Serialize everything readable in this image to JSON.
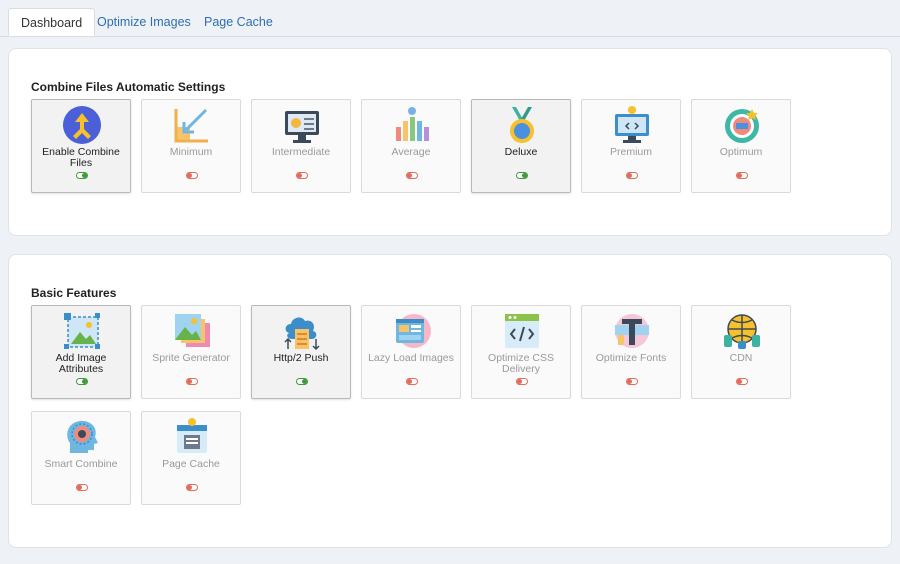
{
  "tabs": [
    {
      "label": "Dashboard",
      "active": true
    },
    {
      "label": "Optimize Images",
      "active": false
    },
    {
      "label": "Page Cache",
      "active": false
    }
  ],
  "combine": {
    "title": "Combine Files Automatic Settings",
    "cards": [
      {
        "label": "Enable Combine Files",
        "icon": "combine-arrows-icon",
        "enabled": true
      },
      {
        "label": "Minimum",
        "icon": "minimum-arrow-icon",
        "enabled": false
      },
      {
        "label": "Intermediate",
        "icon": "monitor-settings-icon",
        "enabled": false
      },
      {
        "label": "Average",
        "icon": "average-bars-icon",
        "enabled": false
      },
      {
        "label": "Deluxe",
        "icon": "medal-icon",
        "enabled": true
      },
      {
        "label": "Premium",
        "icon": "premium-monitor-icon",
        "enabled": false
      },
      {
        "label": "Optimum",
        "icon": "gauge-icon",
        "enabled": false
      }
    ]
  },
  "basic": {
    "title": "Basic Features",
    "cards": [
      {
        "label": "Add Image Attributes",
        "icon": "image-attributes-icon",
        "enabled": true
      },
      {
        "label": "Sprite Generator",
        "icon": "sprite-images-icon",
        "enabled": false
      },
      {
        "label": "Http/2 Push",
        "icon": "cloud-push-icon",
        "enabled": true
      },
      {
        "label": "Lazy Load Images",
        "icon": "lazy-load-icon",
        "enabled": false
      },
      {
        "label": "Optimize CSS Delivery",
        "icon": "css-code-icon",
        "enabled": false
      },
      {
        "label": "Optimize Fonts",
        "icon": "font-icon",
        "enabled": false
      },
      {
        "label": "CDN",
        "icon": "cdn-globe-icon",
        "enabled": false
      },
      {
        "label": "Smart Combine",
        "icon": "smart-head-icon",
        "enabled": false
      },
      {
        "label": "Page Cache",
        "icon": "page-cache-icon",
        "enabled": false
      }
    ]
  },
  "colors": {
    "link": "#2f6db5",
    "toggle_on": "#3f9a3a",
    "toggle_off": "#e26b5b"
  }
}
